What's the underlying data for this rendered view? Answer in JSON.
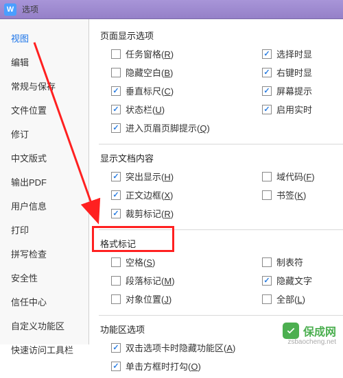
{
  "titlebar": {
    "title": "选项",
    "icon_letter": "W"
  },
  "sidebar": {
    "items": [
      {
        "label": "视图",
        "active": true
      },
      {
        "label": "编辑"
      },
      {
        "label": "常规与保存"
      },
      {
        "label": "文件位置"
      },
      {
        "label": "修订"
      },
      {
        "label": "中文版式"
      },
      {
        "label": "输出PDF"
      },
      {
        "label": "用户信息"
      },
      {
        "label": "打印"
      },
      {
        "label": "拼写检查"
      },
      {
        "label": "安全性"
      },
      {
        "label": "信任中心"
      },
      {
        "label": "自定义功能区"
      },
      {
        "label": "快速访问工具栏"
      }
    ]
  },
  "sections": {
    "display": {
      "title": "页面显示选项",
      "left": [
        {
          "label": "任务窗格(R)",
          "u": "R",
          "checked": false
        },
        {
          "label": "隐藏空白(B)",
          "u": "B",
          "checked": false
        },
        {
          "label": "垂直标尺(C)",
          "u": "C",
          "checked": true
        },
        {
          "label": "状态栏(U)",
          "u": "U",
          "checked": true
        },
        {
          "label": "进入页眉页脚提示(Q)",
          "u": "Q",
          "checked": true
        }
      ],
      "right": [
        {
          "label": "选择时显",
          "checked": true
        },
        {
          "label": "右键时显",
          "checked": true
        },
        {
          "label": "屏幕提示",
          "checked": true
        },
        {
          "label": "启用实时",
          "checked": true
        }
      ]
    },
    "doccontent": {
      "title": "显示文档内容",
      "left": [
        {
          "label": "突出显示(H)",
          "u": "H",
          "checked": true
        },
        {
          "label": "正文边框(X)",
          "u": "X",
          "checked": true
        },
        {
          "label": "裁剪标记(R)",
          "u": "R",
          "checked": true
        }
      ],
      "right": [
        {
          "label": "域代码(F)",
          "u": "F",
          "checked": false
        },
        {
          "label": "书签(K)",
          "u": "K",
          "checked": false
        }
      ]
    },
    "formatmark": {
      "title": "格式标记",
      "left": [
        {
          "label": "空格(S)",
          "u": "S",
          "checked": false
        },
        {
          "label": "段落标记(M)",
          "u": "M",
          "checked": false
        },
        {
          "label": "对象位置(J)",
          "u": "J",
          "checked": false
        }
      ],
      "right": [
        {
          "label": "制表符",
          "checked": false
        },
        {
          "label": "隐藏文字",
          "checked": true
        },
        {
          "label": "全部(L)",
          "u": "L",
          "checked": false
        }
      ]
    },
    "ribbon": {
      "title": "功能区选项",
      "left": [
        {
          "label": "双击选项卡时隐藏功能区(A)",
          "u": "A",
          "checked": true
        },
        {
          "label": "单击方框时打勾(O)",
          "u": "O",
          "checked": true
        }
      ]
    }
  },
  "watermark": {
    "text": "保成网",
    "url": "zsbaocheng.net"
  },
  "check_glyph": "✓"
}
